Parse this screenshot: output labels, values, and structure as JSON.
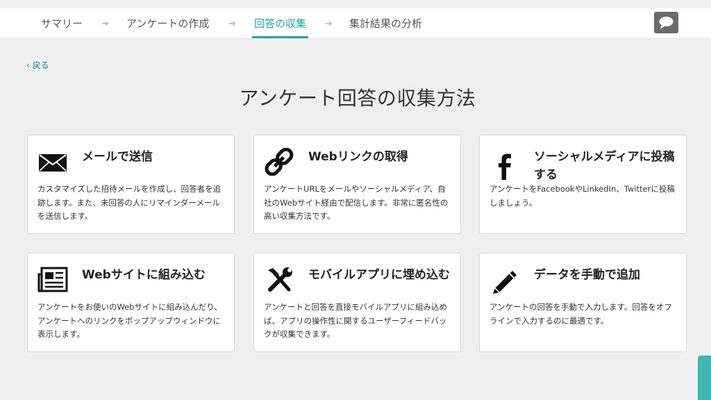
{
  "nav": {
    "steps": [
      {
        "label": "サマリー"
      },
      {
        "label": "アンケートの作成"
      },
      {
        "label": "回答の収集"
      },
      {
        "label": "集計結果の分析"
      }
    ],
    "arrow": "➔",
    "active_index": 2
  },
  "back_label": "‹ 戻る",
  "page_title": "アンケート回答の収集方法",
  "cards": [
    {
      "title": "メールで送信",
      "icon": "envelope-icon",
      "desc": "カスタマイズした招待メールを作成し、回答者を追跡します。また、未回答の人にリマインダーメールを送信します。"
    },
    {
      "title": "Webリンクの取得",
      "icon": "chain-link-icon",
      "desc": "アンケートURLをメールやソーシャルメディア、自社のWebサイト経由で配信します。非常に匿名性の高い収集方法です。"
    },
    {
      "title": "ソーシャルメディアに投稿する",
      "icon": "facebook-icon",
      "desc": "アンケートをFacebookやLinkedIn、Twitterに投稿しましょう。"
    },
    {
      "title": "Webサイトに組み込む",
      "icon": "newspaper-icon",
      "desc": "アンケートをお使いのWebサイトに組み込んだり、アンケートへのリンクをポップアップウィンドウに表示します。"
    },
    {
      "title": "モバイルアプリに埋め込む",
      "icon": "tools-icon",
      "desc": "アンケートと回答を直接モバイルアプリに組み込めば、アプリの操作性に関するユーザーフィードバックが収集できます。"
    },
    {
      "title": "データを手動で追加",
      "icon": "pen-icon",
      "desc": "アンケートの回答を手動で入力します。回答をオフラインで入力するのに最適です。"
    }
  ],
  "colors": {
    "accent": "#1fa7a5",
    "background": "#efefef",
    "card": "#ffffff",
    "side_tab": "#3fb6b1"
  }
}
